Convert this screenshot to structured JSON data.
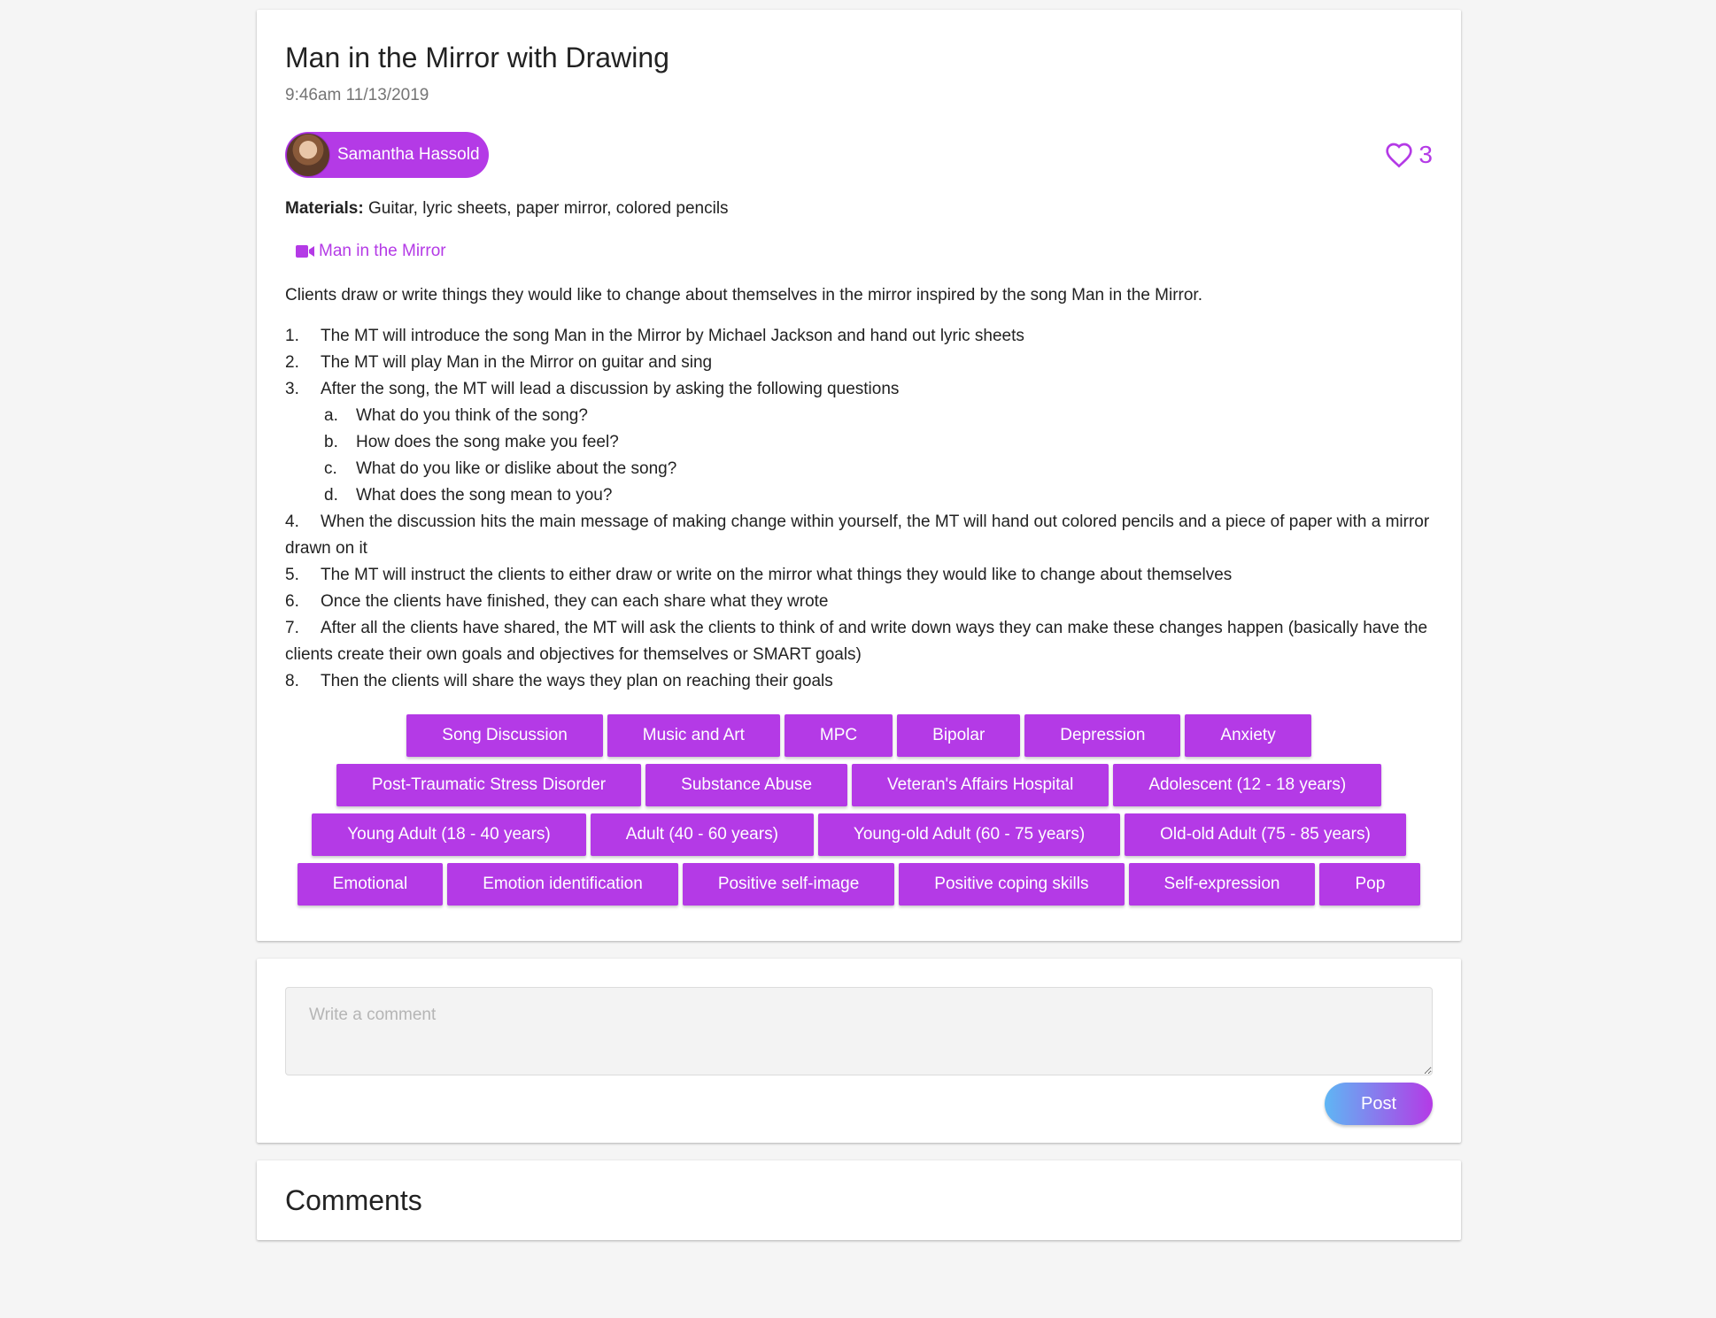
{
  "post": {
    "title": "Man in the Mirror with Drawing",
    "timestamp": "9:46am 11/13/2019",
    "author": "Samantha Hassold",
    "likes": "3",
    "materials_label": "Materials:",
    "materials": "Guitar, lyric sheets, paper mirror, colored pencils",
    "video_label": "Man in the Mirror",
    "description": "Clients draw or write things they would like to change about themselves in the mirror inspired by the song Man in the Mirror.",
    "steps": [
      {
        "num": "1.",
        "text": "The MT will introduce the song Man in the Mirror by Michael Jackson and hand out lyric sheets"
      },
      {
        "num": "2.",
        "text": "The MT will play Man in the Mirror on guitar and sing"
      },
      {
        "num": "3.",
        "text": "After the song, the MT will lead a discussion by asking the following questions"
      },
      {
        "num": "a.",
        "text": "What do you think of the song?"
      },
      {
        "num": "b.",
        "text": "How does the song make you feel?"
      },
      {
        "num": "c.",
        "text": "What do you like or dislike about the song?"
      },
      {
        "num": "d.",
        "text": "What does the song mean to you?"
      },
      {
        "num": "4.",
        "text": "When the discussion hits the main message of making change within yourself, the MT will hand out colored pencils and a piece of paper with a mirror drawn on it"
      },
      {
        "num": "5.",
        "text": "The MT will instruct the clients to either draw or write on the mirror what things they would like to change about themselves"
      },
      {
        "num": "6.",
        "text": "Once the clients have finished, they can each share what they wrote"
      },
      {
        "num": "7.",
        "text": "After all the clients have shared, the MT will ask the clients to think of and write down ways they can make these changes happen (basically have the clients create their own goals and objectives for themselves or SMART goals)"
      },
      {
        "num": "8.",
        "text": "Then the clients will share the ways they plan on reaching their goals"
      }
    ],
    "tags": [
      "Song Discussion",
      "Music and Art",
      "MPC",
      "Bipolar",
      "Depression",
      "Anxiety",
      "Post-Traumatic Stress Disorder",
      "Substance Abuse",
      "Veteran's Affairs Hospital",
      "Adolescent (12 - 18 years)",
      "Young Adult (18 - 40 years)",
      "Adult (40 - 60 years)",
      "Young-old Adult (60 - 75 years)",
      "Old-old Adult (75 - 85 years)",
      "Emotional",
      "Emotion identification",
      "Positive self-image",
      "Positive coping skills",
      "Self-expression",
      "Pop"
    ]
  },
  "comment_form": {
    "placeholder": "Write a comment",
    "post_label": "Post"
  },
  "comments": {
    "title": "Comments"
  },
  "colors": {
    "accent": "#b43ae6",
    "gradient_start": "#5fb6f4"
  }
}
